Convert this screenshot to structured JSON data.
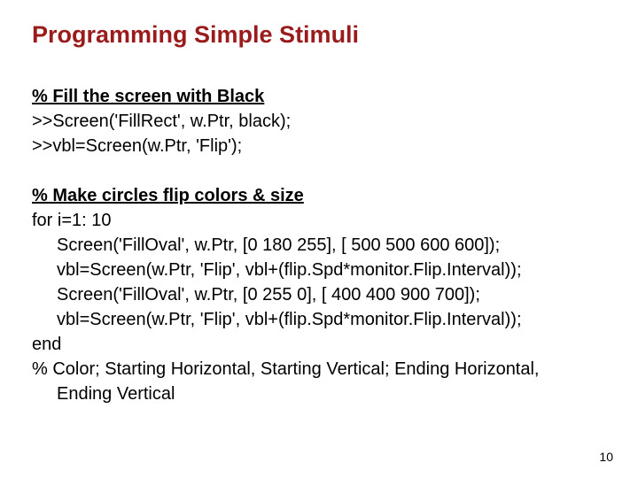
{
  "title": "Programming Simple Stimuli",
  "block1": {
    "heading": "% Fill the screen with Black",
    "lines": [
      ">>Screen('FillRect', w.Ptr, black);",
      ">>vbl=Screen(w.Ptr, 'Flip');"
    ]
  },
  "block2": {
    "heading": "% Make circles flip colors & size",
    "for_line": "for i=1: 10",
    "body": [
      "Screen('FillOval', w.Ptr, [0 180 255], [ 500 500 600 600]);",
      "vbl=Screen(w.Ptr, 'Flip', vbl+(flip.Spd*monitor.Flip.Interval));",
      "Screen('FillOval', w.Ptr, [0 255 0], [ 400 400 900 700]);",
      "vbl=Screen(w.Ptr, 'Flip', vbl+(flip.Spd*monitor.Flip.Interval));"
    ],
    "end_line": "end",
    "comment1": "% Color; Starting Horizontal, Starting Vertical; Ending Horizontal,",
    "comment2": "Ending Vertical"
  },
  "page_number": "10"
}
